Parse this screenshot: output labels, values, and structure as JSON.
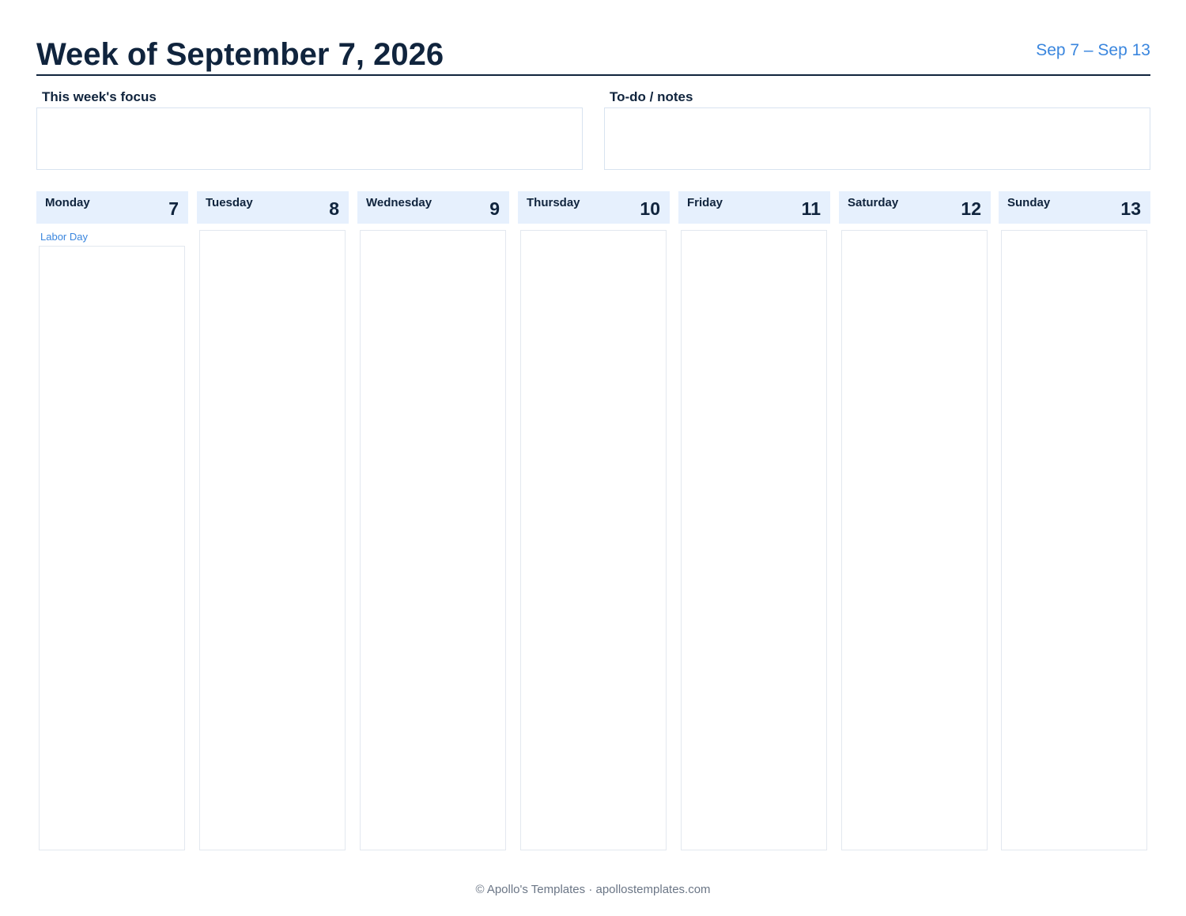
{
  "header": {
    "title": "Week of September 7, 2026",
    "range": "Sep 7 – Sep 13"
  },
  "notes": {
    "focus_label": "This week's focus",
    "todo_label": "To-do / notes"
  },
  "days": [
    {
      "name": "Monday",
      "date": "7",
      "holiday": "Labor Day"
    },
    {
      "name": "Tuesday",
      "date": "8",
      "holiday": ""
    },
    {
      "name": "Wednesday",
      "date": "9",
      "holiday": ""
    },
    {
      "name": "Thursday",
      "date": "10",
      "holiday": ""
    },
    {
      "name": "Friday",
      "date": "11",
      "holiday": ""
    },
    {
      "name": "Saturday",
      "date": "12",
      "holiday": ""
    },
    {
      "name": "Sunday",
      "date": "13",
      "holiday": ""
    }
  ],
  "footer": "© Apollo's Templates · apollostemplates.com",
  "colors": {
    "title": "#10243d",
    "accent": "#3a86de",
    "day_header_bg": "#e6f0fd",
    "border": "#d8e3f0"
  }
}
